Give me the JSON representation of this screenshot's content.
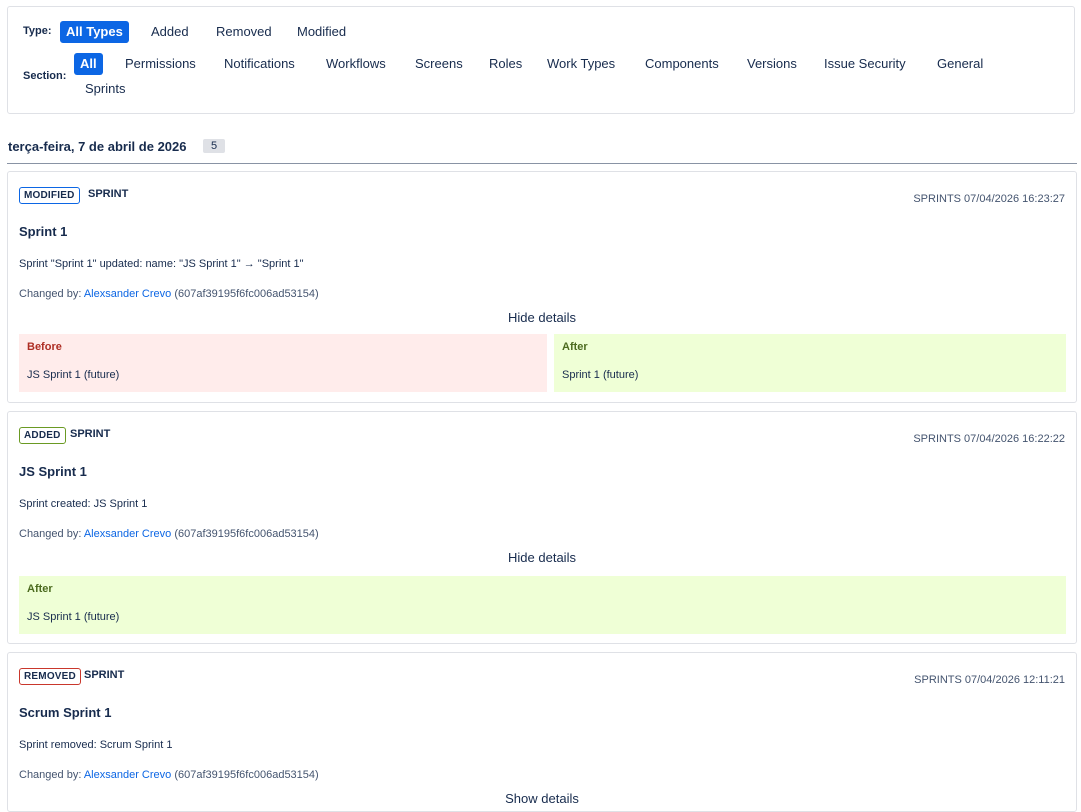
{
  "filters": {
    "type_label": "Type:",
    "type_options": [
      "All Types",
      "Added",
      "Removed",
      "Modified"
    ],
    "type_selected": "All Types",
    "section_label": "Section:",
    "section_options": [
      "All",
      "Permissions",
      "Notifications",
      "Workflows",
      "Screens",
      "Roles",
      "Work Types",
      "Components",
      "Versions",
      "Issue Security",
      "General",
      "Sprints"
    ],
    "section_selected": "All"
  },
  "date_group": {
    "date": "terça-feira, 7 de abril de 2026",
    "count": "5"
  },
  "entries": [
    {
      "badge": "MODIFIED",
      "entity": "SPRINT",
      "meta": "SPRINTS 07/04/2026 16:23:27",
      "title": "Sprint 1",
      "description": "Sprint \"Sprint 1\" updated: name: \"JS Sprint 1\" → \"Sprint 1\"",
      "changed_by_label": "Changed by:",
      "user": "Alexsander Crevo",
      "user_id": "(607af39195f6fc006ad53154)",
      "toggle": "Hide details",
      "before_label": "Before",
      "before_value": "JS Sprint 1 (future)",
      "after_label": "After",
      "after_value": "Sprint 1 (future)"
    },
    {
      "badge": "ADDED",
      "entity": "SPRINT",
      "meta": "SPRINTS 07/04/2026 16:22:22",
      "title": "JS Sprint 1",
      "description": "Sprint created: JS Sprint 1",
      "changed_by_label": "Changed by:",
      "user": "Alexsander Crevo",
      "user_id": "(607af39195f6fc006ad53154)",
      "toggle": "Hide details",
      "after_label": "After",
      "after_value": "JS Sprint 1 (future)"
    },
    {
      "badge": "REMOVED",
      "entity": "SPRINT",
      "meta": "SPRINTS 07/04/2026 12:11:21",
      "title": "Scrum Sprint 1",
      "description": "Sprint removed: Scrum Sprint 1",
      "changed_by_label": "Changed by:",
      "user": "Alexsander Crevo",
      "user_id": "(607af39195f6fc006ad53154)",
      "toggle": "Show details"
    }
  ]
}
